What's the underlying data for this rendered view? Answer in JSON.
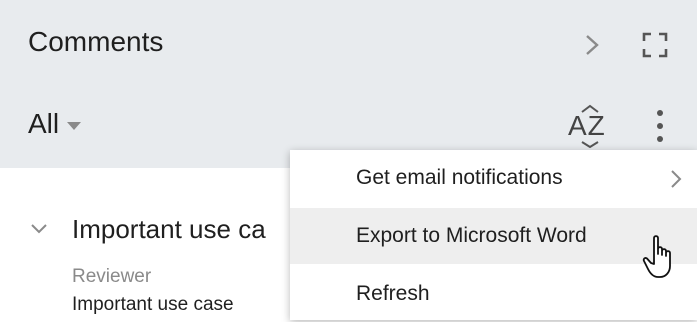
{
  "panel": {
    "title": "Comments",
    "filter_label": "All",
    "sort_icon_text": "AZ"
  },
  "comment": {
    "title": "Important use ca",
    "role": "Reviewer",
    "body": "Important use case"
  },
  "menu": {
    "items": [
      {
        "label": "Get email notifications",
        "has_submenu": true
      },
      {
        "label": "Export to Microsoft Word",
        "hovered": true
      },
      {
        "label": "Refresh"
      }
    ]
  },
  "colors": {
    "header_bg": "#e8ebee",
    "menu_hover_bg": "#eeeeee",
    "secondary_text": "#8a8a8a"
  }
}
